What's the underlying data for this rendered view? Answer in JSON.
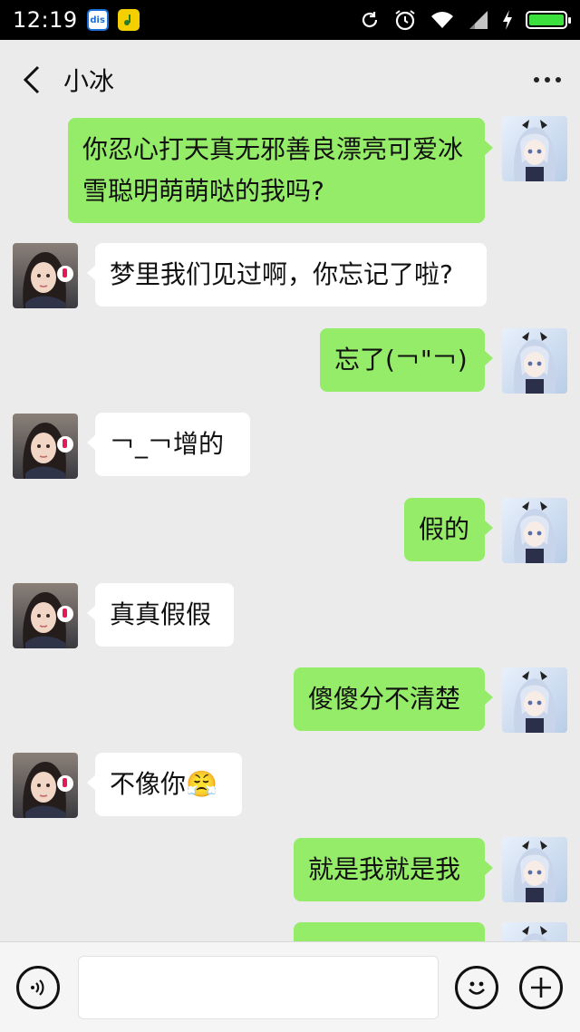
{
  "status_bar": {
    "time": "12:19",
    "app_icon_1_label": "dis",
    "icons": [
      "sync-icon",
      "alarm-icon",
      "wifi-icon",
      "signal-icon",
      "charging-icon"
    ],
    "battery_level": 1.0,
    "battery_color": "#3ce03c"
  },
  "header": {
    "title": "小冰"
  },
  "colors": {
    "sent_bubble": "#95ec69",
    "received_bubble": "#ffffff",
    "background": "#ebebeb"
  },
  "messages": [
    {
      "from": "me",
      "text": "你忍心打天真无邪善良漂亮可爱冰雪聪明萌萌哒的我吗?"
    },
    {
      "from": "them",
      "text": "梦里我们见过啊，你忘记了啦?"
    },
    {
      "from": "me",
      "text": "忘了(￢\"￢)"
    },
    {
      "from": "them",
      "text": "￢_￢增的"
    },
    {
      "from": "me",
      "text": "假的"
    },
    {
      "from": "them",
      "text": "真真假假"
    },
    {
      "from": "me",
      "text": "傻傻分不清楚"
    },
    {
      "from": "them",
      "text": "不像你😤"
    },
    {
      "from": "me",
      "text": "就是我就是我"
    },
    {
      "from": "me",
      "text": ""
    }
  ],
  "input": {
    "value": "",
    "icons": [
      "voice-icon",
      "emoji-icon",
      "plus-icon"
    ]
  }
}
